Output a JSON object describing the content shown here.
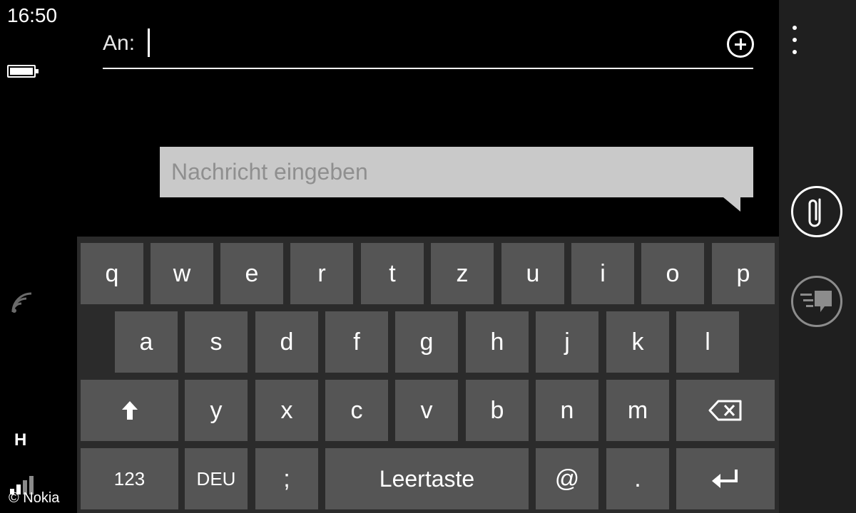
{
  "status": {
    "time": "16:50",
    "network_type": "H"
  },
  "credit": "© Nokia",
  "recipient": {
    "label": "An:",
    "value": ""
  },
  "message": {
    "placeholder": "Nachricht eingeben"
  },
  "keyboard": {
    "row1": [
      "q",
      "w",
      "e",
      "r",
      "t",
      "z",
      "u",
      "i",
      "o",
      "p"
    ],
    "row2": [
      "a",
      "s",
      "d",
      "f",
      "g",
      "h",
      "j",
      "k",
      "l"
    ],
    "row3": [
      "y",
      "x",
      "c",
      "v",
      "b",
      "n",
      "m"
    ],
    "row4": {
      "numbers": "123",
      "language": "DEU",
      "semicolon": ";",
      "space": "Leertaste",
      "at": "@",
      "period": "."
    }
  },
  "icons": {
    "add_recipient": "plus-circle-icon",
    "more": "ellipsis-icon",
    "attach": "paperclip-icon",
    "send": "send-icon",
    "shift": "arrow-up-icon",
    "backspace": "backspace-icon",
    "enter": "enter-icon",
    "battery": "battery-icon",
    "wifi": "wifi-icon",
    "signal": "signal-icon"
  },
  "colors": {
    "key": "#555555",
    "keyboard_bg": "#2b2b2b",
    "bubble": "#c9c9c9",
    "appbar": "#1f1f1f"
  }
}
